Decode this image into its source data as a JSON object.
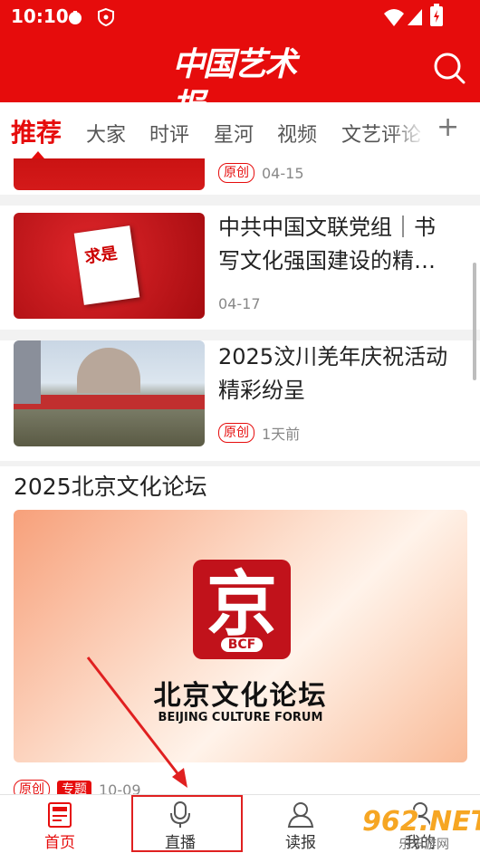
{
  "status_bar": {
    "time": "10:10"
  },
  "header": {
    "logo_text": "中国艺术报"
  },
  "tabs": [
    {
      "label": "推荐",
      "active": true
    },
    {
      "label": "大家"
    },
    {
      "label": "时评"
    },
    {
      "label": "星河"
    },
    {
      "label": "视频"
    },
    {
      "label": "文艺评论"
    }
  ],
  "feed": {
    "items": [
      {
        "title": "",
        "badge": "原创",
        "date": "04-15"
      },
      {
        "title_line1": "中共中国文联党组｜书",
        "title_line2": "写文化强国建设的精…",
        "date": "04-17",
        "thumb_text": "求是"
      },
      {
        "title_line1": "2025汶川羌年庆祝活动",
        "title_line2": "精彩纷呈",
        "badge": "原创",
        "date": "1天前"
      }
    ],
    "section": {
      "title": "2025北京文化论坛",
      "banner_char": "京",
      "banner_bcf": "BCF",
      "banner_cn": "北京文化论坛",
      "banner_en": "BEIJING CULTURE FORUM",
      "badge_orig": "原创",
      "badge_topic": "专题",
      "date": "10-09"
    }
  },
  "bottom_nav": [
    {
      "label": "首页",
      "active": true
    },
    {
      "label": "直播"
    },
    {
      "label": "读报"
    },
    {
      "label": "我的"
    }
  ],
  "colors": {
    "brand_red": "#e60c0c",
    "annotation_red": "#e02020"
  },
  "watermark": {
    "text": "962.NET",
    "sub": "乐乐游网"
  }
}
